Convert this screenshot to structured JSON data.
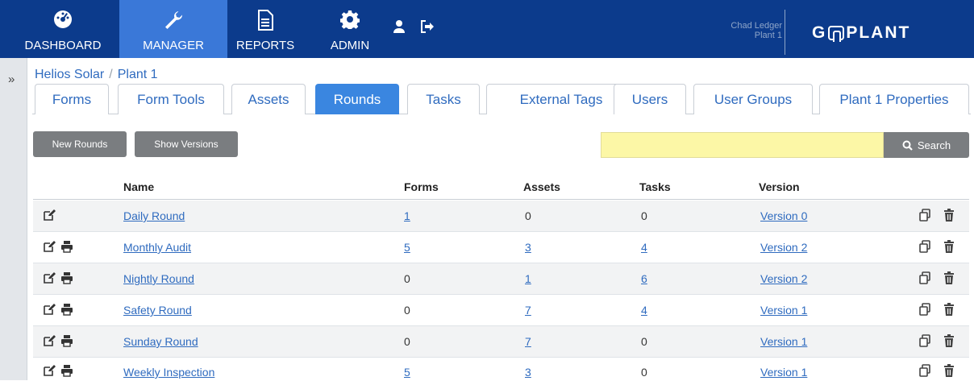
{
  "nav": {
    "items": [
      {
        "label": "DASHBOARD",
        "icon": "dashboard-gauge-icon"
      },
      {
        "label": "MANAGER",
        "icon": "wrench-icon",
        "active": true
      },
      {
        "label": "REPORTS",
        "icon": "document-icon"
      },
      {
        "label": "ADMIN",
        "icon": "gear-icon"
      }
    ],
    "utility_icons": [
      "user-icon",
      "logout-icon"
    ]
  },
  "user": {
    "name": "Chad Ledger",
    "plant": "Plant 1"
  },
  "logo": {
    "prefix": "G",
    "suffix": "PLANT"
  },
  "colors": {
    "header": "#0c3b8c",
    "active_nav": "#3a78d8",
    "active_tab": "#3a86e0",
    "link": "#2f6bbf",
    "search_bg": "#fcf7a6",
    "button": "#7a7d80"
  },
  "sidebar": {
    "toggle": "»"
  },
  "breadcrumb": {
    "items": [
      "Helios Solar",
      "Plant 1"
    ],
    "separator": "/"
  },
  "tabs": [
    {
      "label": "Forms"
    },
    {
      "label": "Form Tools"
    },
    {
      "label": "Assets"
    },
    {
      "label": "Rounds",
      "active": true
    },
    {
      "label": "Tasks"
    },
    {
      "label": "External Tags"
    },
    {
      "label": "Users"
    },
    {
      "label": "User Groups"
    },
    {
      "label": "Plant 1 Properties"
    }
  ],
  "toolbar": {
    "new_label": "New Rounds",
    "versions_label": "Show Versions",
    "search_value": "",
    "search_label": "Search"
  },
  "table": {
    "columns": [
      "Name",
      "Forms",
      "Assets",
      "Tasks",
      "Version"
    ],
    "rows": [
      {
        "name": "Daily Round",
        "forms": "1",
        "assets": "0",
        "tasks": "0",
        "version": "Version 0",
        "printable": false
      },
      {
        "name": "Monthly Audit",
        "forms": "5",
        "assets": "3",
        "tasks": "4",
        "version": "Version 2",
        "printable": true
      },
      {
        "name": "Nightly Round",
        "forms": "0",
        "assets": "1",
        "tasks": "6",
        "version": "Version 2",
        "printable": true
      },
      {
        "name": "Safety Round",
        "forms": "0",
        "assets": "7",
        "tasks": "4",
        "version": "Version 1",
        "printable": true
      },
      {
        "name": "Sunday Round",
        "forms": "0",
        "assets": "7",
        "tasks": "0",
        "version": "Version 1",
        "printable": true
      },
      {
        "name": "Weekly Inspection",
        "forms": "5",
        "assets": "3",
        "tasks": "0",
        "version": "Version 1",
        "printable": true
      }
    ]
  }
}
